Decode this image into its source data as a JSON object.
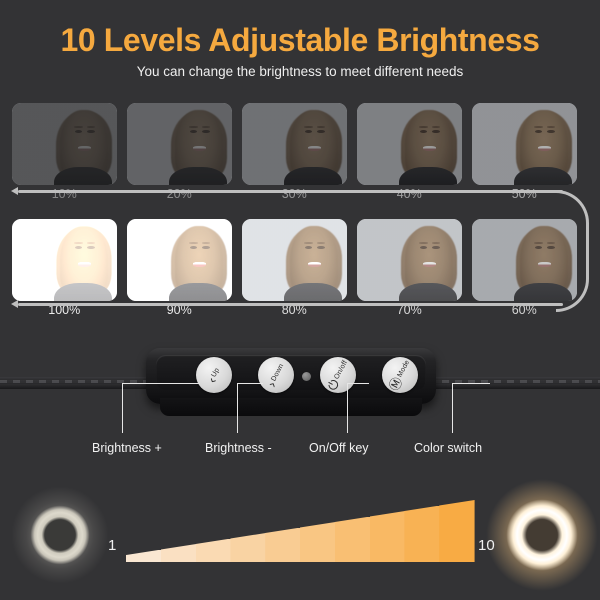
{
  "header": {
    "title": "10 Levels Adjustable Brightness",
    "subtitle": "You can change the brightness to meet different needs",
    "title_color": "#f5a93f",
    "background_color": "#333335"
  },
  "brightness_grid": {
    "row1": [
      {
        "label": "10%",
        "level": 10
      },
      {
        "label": "20%",
        "level": 20
      },
      {
        "label": "30%",
        "level": 30
      },
      {
        "label": "40%",
        "level": 40
      },
      {
        "label": "50%",
        "level": 50
      }
    ],
    "row2": [
      {
        "label": "100%",
        "level": 100
      },
      {
        "label": "90%",
        "level": 90
      },
      {
        "label": "80%",
        "level": 80
      },
      {
        "label": "70%",
        "level": 70
      },
      {
        "label": "60%",
        "level": 60
      }
    ]
  },
  "device": {
    "buttons": [
      {
        "name": "up",
        "glyph": "‹",
        "label": "Up"
      },
      {
        "name": "down",
        "glyph": "›",
        "label": "Down"
      },
      {
        "name": "onoff",
        "glyph": "⏻",
        "label": "On/off"
      },
      {
        "name": "mode",
        "glyph": "Ⓜ",
        "label": "Mode"
      }
    ],
    "callouts": [
      {
        "name": "brightness-up",
        "label": "Brightness +"
      },
      {
        "name": "brightness-down",
        "label": "Brightness -"
      },
      {
        "name": "onoff-key",
        "label": "On/Off key"
      },
      {
        "name": "color-switch",
        "label": "Color switch"
      }
    ]
  },
  "scale": {
    "min_label": "1",
    "max_label": "10",
    "steps": 10,
    "low_color": "#faeada",
    "high_color": "#f8a83c"
  }
}
